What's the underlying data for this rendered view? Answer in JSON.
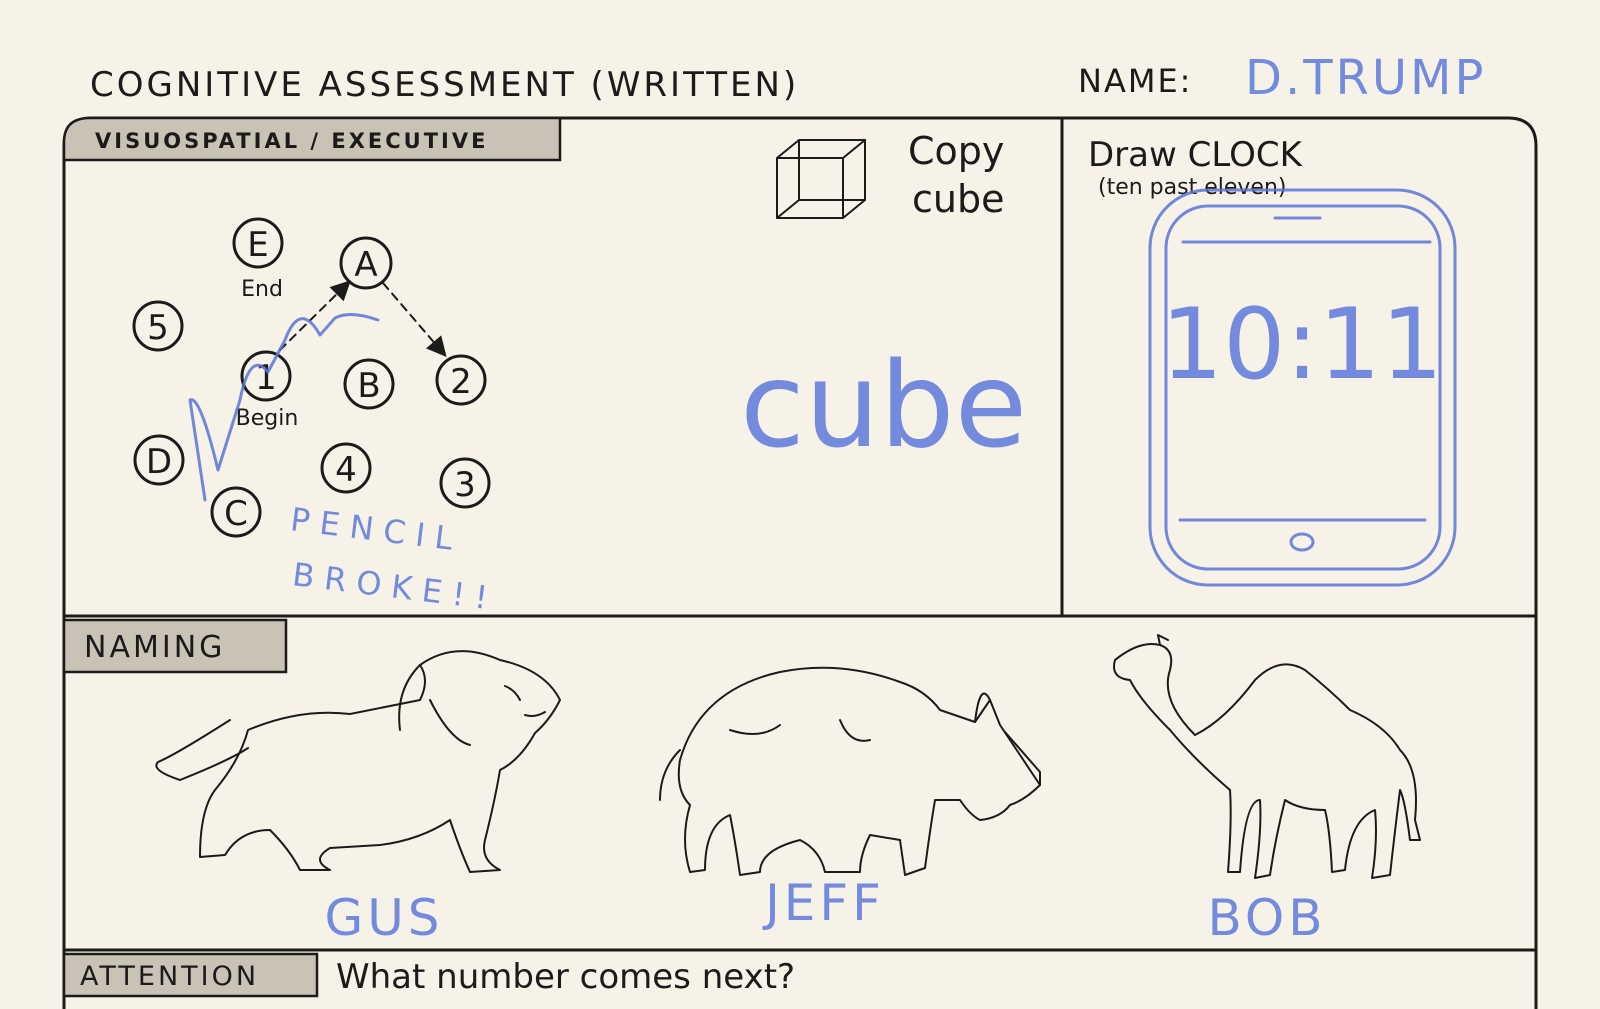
{
  "header": {
    "title": "COGNITIVE ASSESSMENT (WRITTEN)",
    "name_label": "NAME:",
    "name_value": "D.TRUMP"
  },
  "visuospatial": {
    "section_label": "VISUOSPATIAL / EXECUTIVE",
    "trail_nodes": [
      "E",
      "A",
      "5",
      "1",
      "B",
      "2",
      "D",
      "4",
      "3",
      "C"
    ],
    "end_label": "End",
    "begin_label": "Begin",
    "pencil_note_line1": "PENCIL",
    "pencil_note_line2": "BROKE!!",
    "cube_prompt_line1": "Copy",
    "cube_prompt_line2": "cube",
    "cube_answer": "cube",
    "clock_prompt": "Draw CLOCK",
    "clock_subprompt": "(ten past eleven)",
    "clock_answer": "10:11"
  },
  "naming": {
    "section_label": "NAMING",
    "animals": [
      {
        "icon": "lion-icon",
        "answer": "GUS"
      },
      {
        "icon": "rhino-icon",
        "answer": "JEFF"
      },
      {
        "icon": "camel-icon",
        "answer": "BOB"
      }
    ]
  },
  "attention": {
    "section_label": "ATTENTION",
    "prompt": "What number comes next?"
  },
  "colors": {
    "ink": "#1b1b1b",
    "pencil": "#6680dc",
    "paper": "#f6f2e7",
    "tab": "#c8c3b4"
  }
}
